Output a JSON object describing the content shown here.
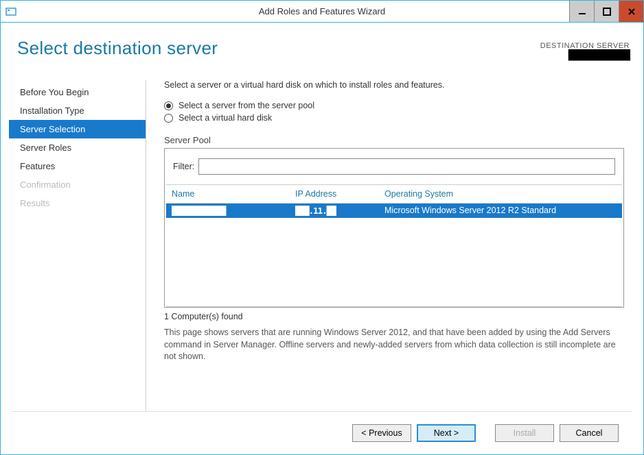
{
  "titlebar": {
    "title": "Add Roles and Features Wizard"
  },
  "header": {
    "page_title": "Select destination server",
    "destination_label": "DESTINATION SERVER",
    "destination_value": "████████████"
  },
  "sidebar": {
    "items": [
      {
        "label": "Before You Begin",
        "state": "normal"
      },
      {
        "label": "Installation Type",
        "state": "normal"
      },
      {
        "label": "Server Selection",
        "state": "selected"
      },
      {
        "label": "Server Roles",
        "state": "normal"
      },
      {
        "label": "Features",
        "state": "normal"
      },
      {
        "label": "Confirmation",
        "state": "disabled"
      },
      {
        "label": "Results",
        "state": "disabled"
      }
    ]
  },
  "main": {
    "instruction": "Select a server or a virtual hard disk on which to install roles and features.",
    "radio_options": [
      {
        "label": "Select a server from the server pool",
        "checked": true
      },
      {
        "label": "Select a virtual hard disk",
        "checked": false
      }
    ],
    "pool_label": "Server Pool",
    "filter_label": "Filter:",
    "filter_value": "",
    "columns": {
      "name": "Name",
      "ip": "IP Address",
      "os": "Operating System"
    },
    "rows": [
      {
        "name": "████████████",
        "ip": "███.11.██",
        "os": "Microsoft Windows Server 2012 R2 Standard",
        "selected": true
      }
    ],
    "found_text": "1 Computer(s) found",
    "help_text": "This page shows servers that are running Windows Server 2012, and that have been added by using the Add Servers command in Server Manager. Offline servers and newly-added servers from which data collection is still incomplete are not shown."
  },
  "footer": {
    "previous": "< Previous",
    "next": "Next >",
    "install": "Install",
    "cancel": "Cancel"
  }
}
